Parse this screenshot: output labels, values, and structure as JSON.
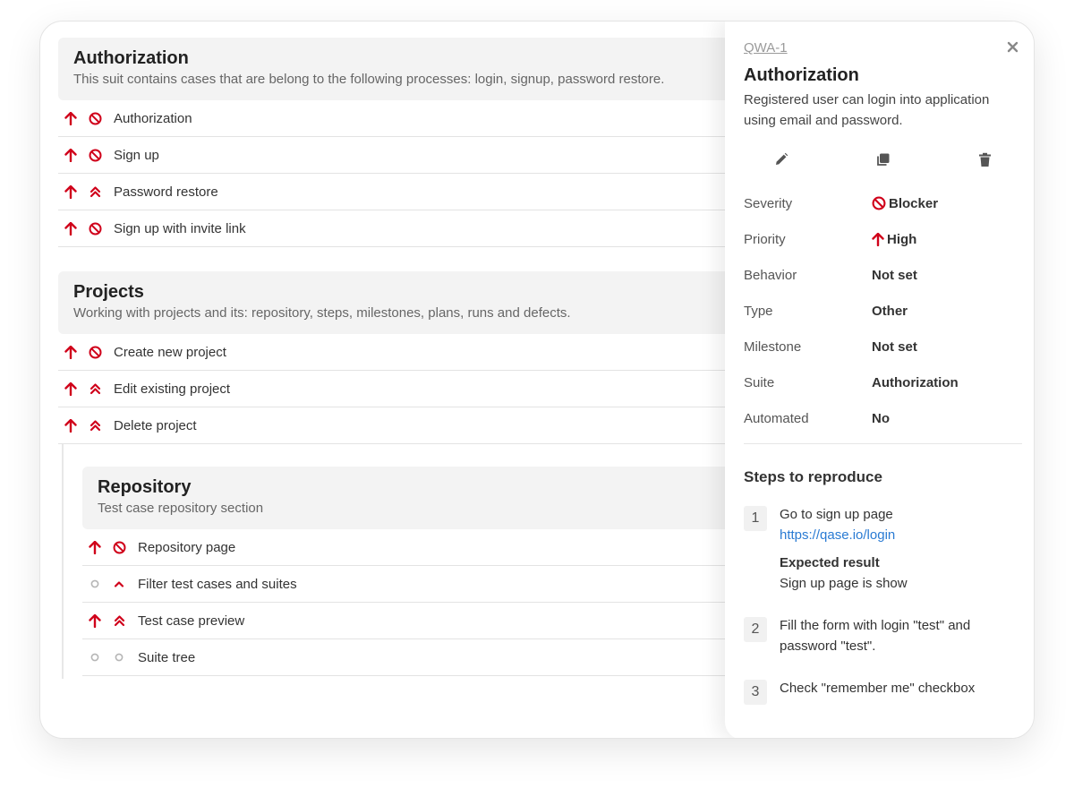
{
  "colors": {
    "accent_red": "#d0021b",
    "muted_icon": "#b5b5b5",
    "link_blue": "#2a7bd3"
  },
  "suites": [
    {
      "title": "Authorization",
      "description": "This suit contains cases that are belong to the following processes: login, signup, password restore.",
      "cases": [
        {
          "title": "Authorization",
          "priority_icon": "arrow-up-icon",
          "severity_icon": "blocker-icon"
        },
        {
          "title": "Sign up",
          "priority_icon": "arrow-up-icon",
          "severity_icon": "blocker-icon"
        },
        {
          "title": "Password restore",
          "priority_icon": "arrow-up-icon",
          "severity_icon": "double-chevron-up-icon"
        },
        {
          "title": "Sign up with invite link",
          "priority_icon": "arrow-up-icon",
          "severity_icon": "blocker-icon"
        }
      ]
    },
    {
      "title": "Projects",
      "description": "Working with projects and its: repository, steps, milestones, plans, runs and defects.",
      "cases": [
        {
          "title": "Create new project",
          "priority_icon": "arrow-up-icon",
          "severity_icon": "blocker-icon"
        },
        {
          "title": "Edit existing project",
          "priority_icon": "arrow-up-icon",
          "severity_icon": "double-chevron-up-icon"
        },
        {
          "title": "Delete project",
          "priority_icon": "arrow-up-icon",
          "severity_icon": "double-chevron-up-icon"
        }
      ]
    },
    {
      "title": "Repository",
      "description": "Test case repository section",
      "cases": [
        {
          "title": "Repository page",
          "priority_icon": "arrow-up-icon",
          "severity_icon": "blocker-icon"
        },
        {
          "title": "Filter test cases and suites",
          "priority_icon": "circle-icon",
          "severity_icon": "chevron-up-icon"
        },
        {
          "title": "Test case preview",
          "priority_icon": "arrow-up-icon",
          "severity_icon": "double-chevron-up-icon"
        },
        {
          "title": "Suite tree",
          "priority_icon": "circle-icon",
          "severity_icon": "circle-icon"
        }
      ]
    }
  ],
  "detail": {
    "case_id": "QWA-1",
    "title": "Authorization",
    "description": "Registered user can login into application using email and password.",
    "actions": [
      "edit-icon",
      "copy-icon",
      "trash-icon"
    ],
    "properties": [
      {
        "label": "Severity",
        "value": "Blocker",
        "icon": "blocker-icon"
      },
      {
        "label": "Priority",
        "value": "High",
        "icon": "arrow-up-icon"
      },
      {
        "label": "Behavior",
        "value": "Not set"
      },
      {
        "label": "Type",
        "value": "Other"
      },
      {
        "label": "Milestone",
        "value": "Not set"
      },
      {
        "label": "Suite",
        "value": "Authorization"
      },
      {
        "label": "Automated",
        "value": "No"
      }
    ],
    "steps_title": "Steps to reproduce",
    "expected_label": "Expected result",
    "steps": [
      {
        "number": "1",
        "action": "Go to sign up page",
        "link": "https://qase.io/login",
        "expected": "Sign up page is show"
      },
      {
        "number": "2",
        "action": "Fill the form with login \"test\" and password \"test\"."
      },
      {
        "number": "3",
        "action": "Check \"remember me\" checkbox"
      }
    ]
  }
}
